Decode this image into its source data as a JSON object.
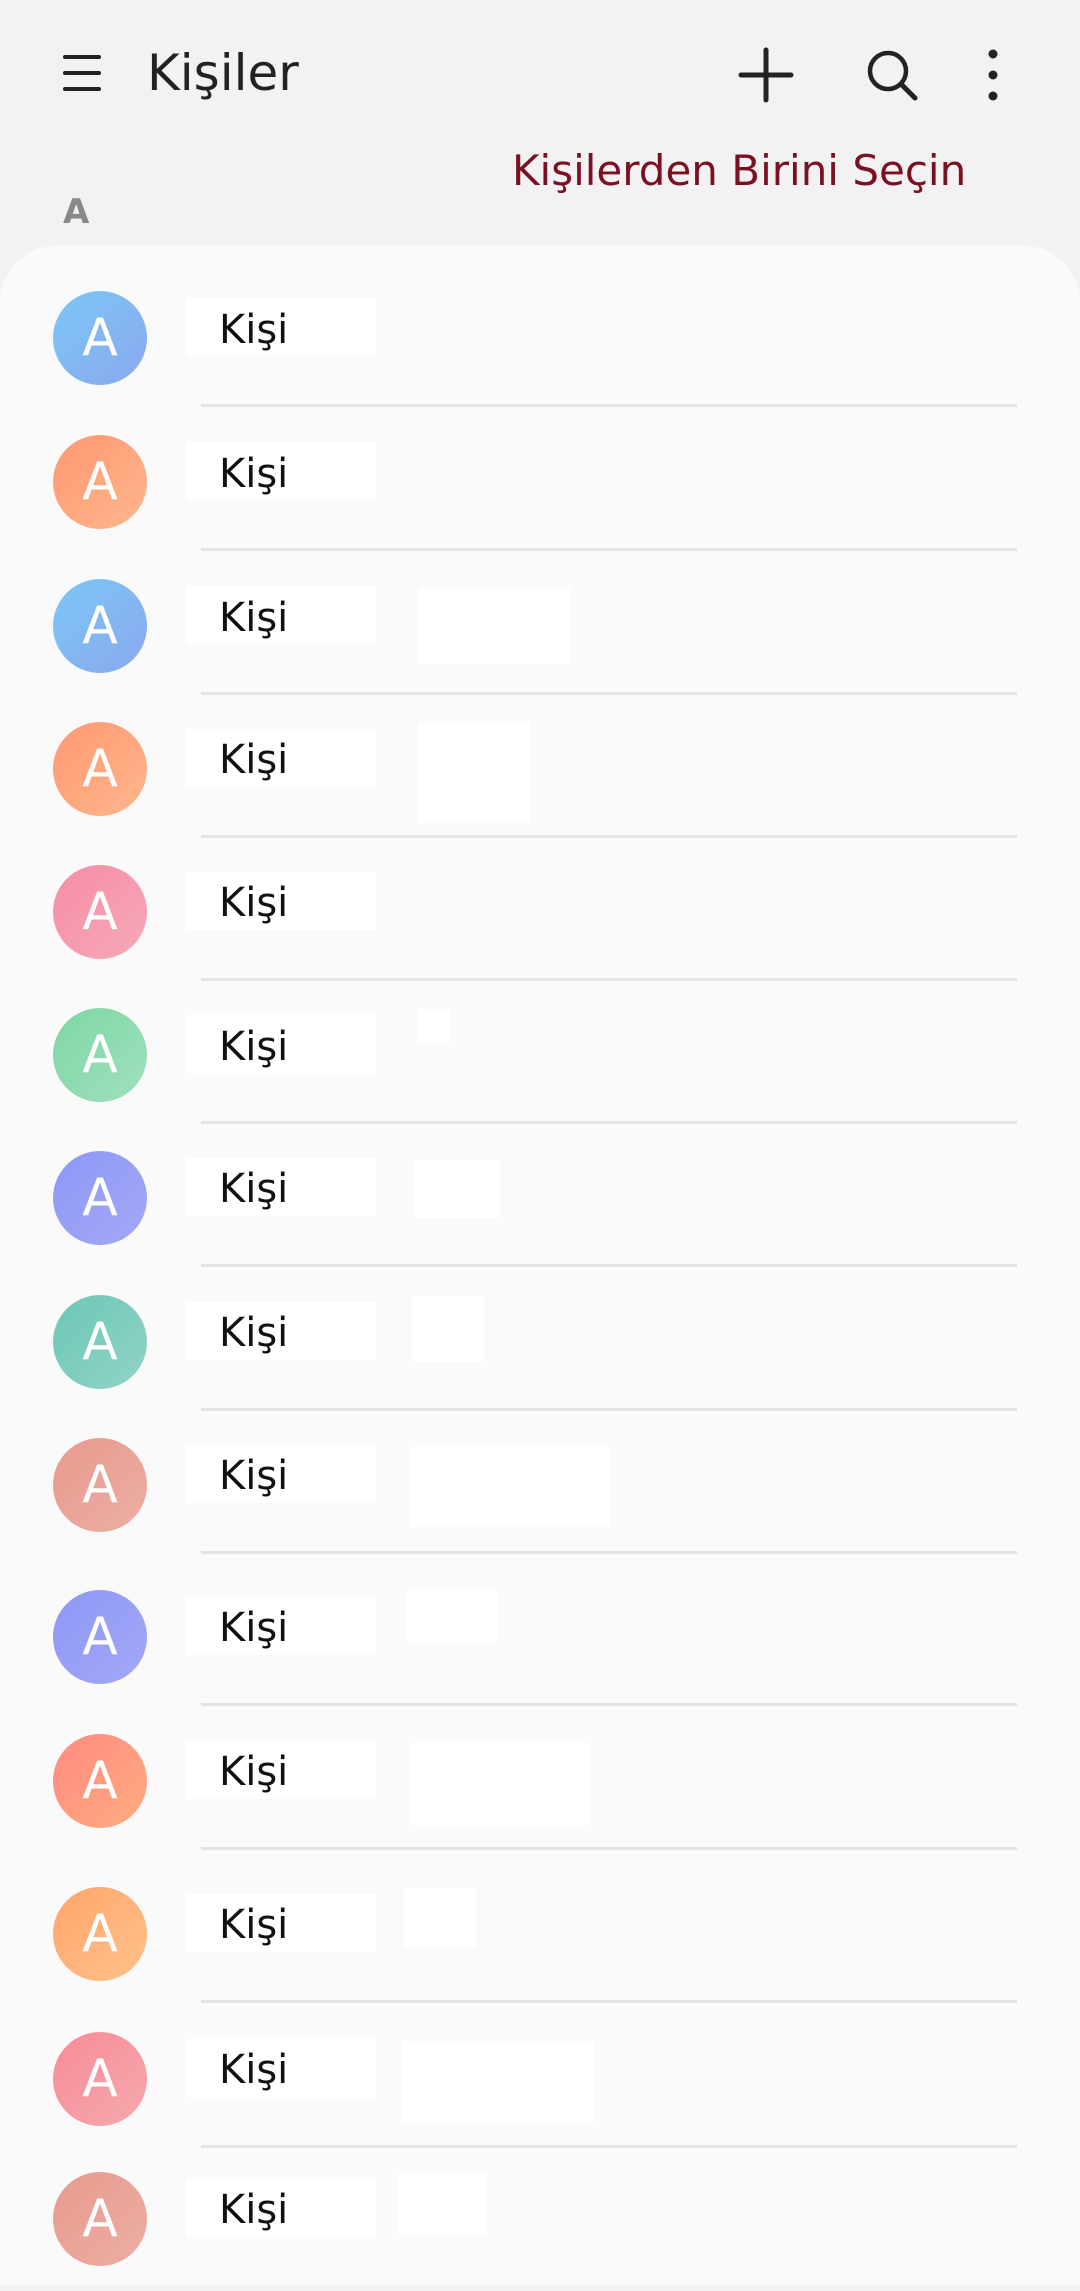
{
  "header": {
    "title": "Kişiler",
    "menu_icon": "hamburger-menu-icon",
    "add_icon": "plus-icon",
    "search_icon": "search-icon",
    "more_icon": "more-vertical-icon"
  },
  "prompt": "Kişilerden Birini Seçin",
  "section_letter": "A",
  "contacts": [
    {
      "initial": "A",
      "name": "Kişi",
      "color_a": "#7cc7f5",
      "color_b": "#8aa8ef"
    },
    {
      "initial": "A",
      "name": "Kişi",
      "color_a": "#ff9873",
      "color_b": "#ffb68c"
    },
    {
      "initial": "A",
      "name": "Kişi",
      "color_a": "#7cc7f5",
      "color_b": "#8aa8ef"
    },
    {
      "initial": "A",
      "name": "Kişi",
      "color_a": "#ff9873",
      "color_b": "#ffb68c"
    },
    {
      "initial": "A",
      "name": "Kişi",
      "color_a": "#f58ca6",
      "color_b": "#f7a9b8"
    },
    {
      "initial": "A",
      "name": "Kişi",
      "color_a": "#7fd6a4",
      "color_b": "#9fe0bd"
    },
    {
      "initial": "A",
      "name": "Kişi",
      "color_a": "#8d98f5",
      "color_b": "#a3a8f7"
    },
    {
      "initial": "A",
      "name": "Kişi",
      "color_a": "#6cc7b5",
      "color_b": "#92d3c7"
    },
    {
      "initial": "A",
      "name": "Kişi",
      "color_a": "#e79a8e",
      "color_b": "#edaea3"
    },
    {
      "initial": "A",
      "name": "Kişi",
      "color_a": "#8d98f5",
      "color_b": "#a3a8f7"
    },
    {
      "initial": "A",
      "name": "Kişi",
      "color_a": "#ff8a80",
      "color_b": "#ffac80"
    },
    {
      "initial": "A",
      "name": "Kişi",
      "color_a": "#ffa46b",
      "color_b": "#ffc28a"
    },
    {
      "initial": "A",
      "name": "Kişi",
      "color_a": "#f78b98",
      "color_b": "#f5a9ae"
    },
    {
      "initial": "A",
      "name": "Kişi",
      "color_a": "#e79a8e",
      "color_b": "#edaea3"
    }
  ]
}
